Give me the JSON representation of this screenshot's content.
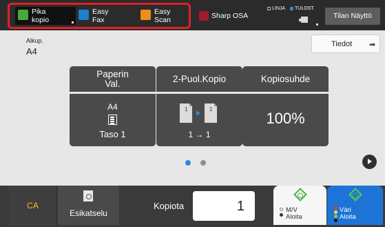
{
  "topbar": {
    "shortcuts": [
      {
        "label": "Pika\nkopio",
        "icon": "copy-icon"
      },
      {
        "label": "Easy\nFax",
        "icon": "fax-icon"
      },
      {
        "label": "Easy\nScan",
        "icon": "scan-icon"
      }
    ],
    "osa": {
      "label": "Sharp OSA",
      "icon": "osa-icon"
    },
    "indicators": {
      "line": "LINJA",
      "print": "TULOST."
    },
    "status_button": "Tilan Näyttö"
  },
  "original": {
    "label": "Alkup.",
    "value": "A4"
  },
  "details_button": "Tiedot",
  "tiles": [
    {
      "title": "Paperin\nVal.",
      "size": "A4",
      "tray": "Taso 1"
    },
    {
      "title": "2-Puol.Kopio",
      "mode": "1 → 1",
      "page_left": "1",
      "page_right": "1"
    },
    {
      "title": "Kopiosuhde",
      "ratio": "100%"
    }
  ],
  "pager": {
    "current": 1,
    "total": 2
  },
  "bottombar": {
    "ca": "CA",
    "preview": "Esikatselu",
    "copies_label": "Kopiota",
    "copies_value": "1",
    "mono_start": "M/V\nAloita",
    "color_start": "Väri\nAloita"
  },
  "colors": {
    "highlight": "#e0202a",
    "ca_text": "#f3c31e",
    "color_start_bg": "#1d74d6",
    "page_dot_active": "#2f87e0"
  }
}
